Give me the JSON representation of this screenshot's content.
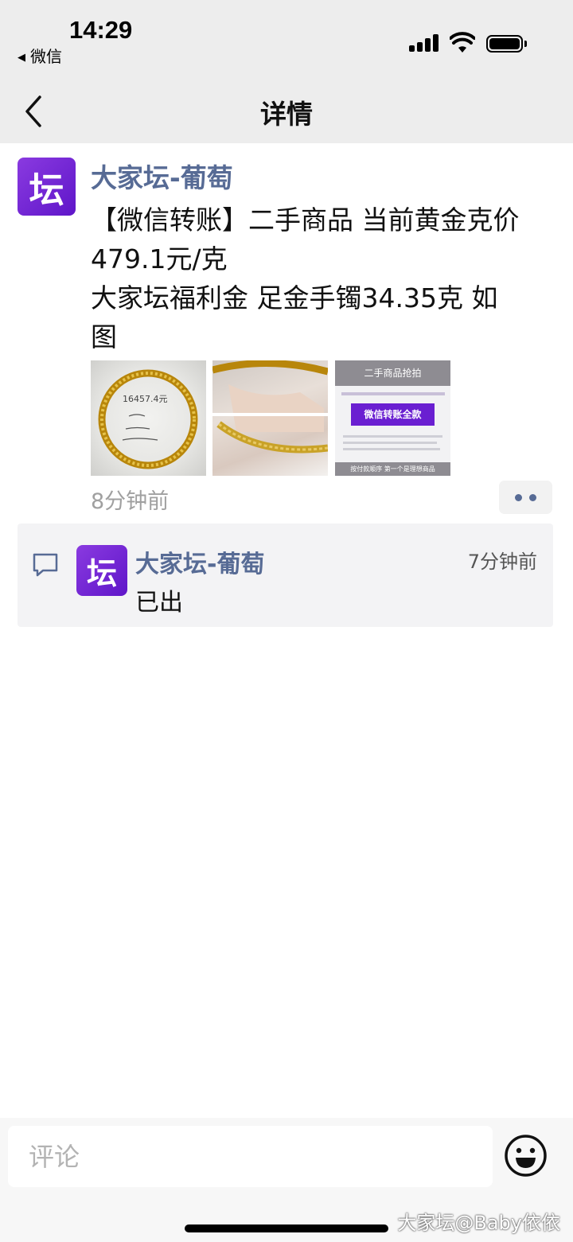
{
  "status_bar": {
    "time": "14:29",
    "back_app": "微信"
  },
  "nav": {
    "title": "详情"
  },
  "post": {
    "avatar_char": "坛",
    "author": "大家坛-葡萄",
    "text_lines": [
      "【微信转账】二手商品 当前黄金克价",
      "479.1元/克",
      "大家坛福利金 足金手镯34.35克 如",
      "图"
    ],
    "images": [
      {
        "kind": "bracelet-on-table",
        "handwriting": "16457.4元"
      },
      {
        "kind": "bracelet-in-hand"
      },
      {
        "kind": "promo-card",
        "header": "二手商品抢拍",
        "banner": "微信转账全款",
        "footer": "按付款顺序 第一个是理想商品"
      }
    ],
    "time": "8分钟前"
  },
  "comments": [
    {
      "avatar_char": "坛",
      "author": "大家坛-葡萄",
      "time": "7分钟前",
      "text": "已出"
    }
  ],
  "bottom": {
    "comment_placeholder": "评论",
    "watermark": "大家坛@Baby依依"
  },
  "colors": {
    "link_blue": "#576b95",
    "avatar_purple": "#6a1fd1",
    "gold": "#c9a227"
  }
}
